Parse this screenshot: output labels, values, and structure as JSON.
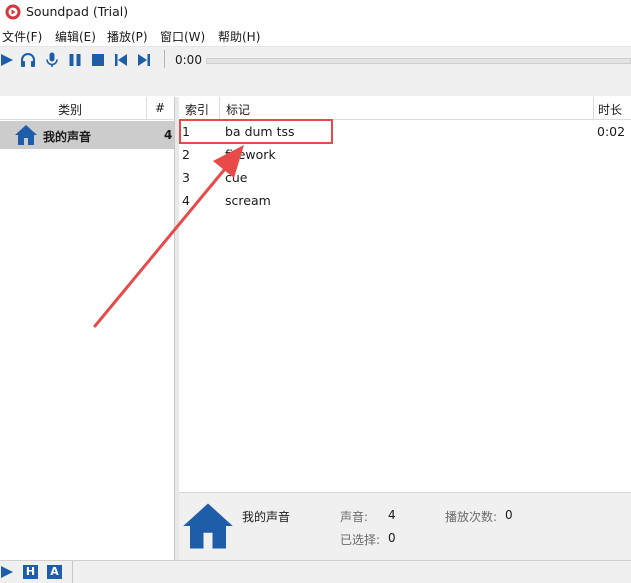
{
  "window": {
    "title": "Soundpad (Trial)"
  },
  "menu": [
    "文件(F)",
    "编辑(E)",
    "播放(P)",
    "窗口(W)",
    "帮助(H)"
  ],
  "toolbar": {
    "time": "0:00",
    "icons": [
      "play-icon",
      "headphones-icon",
      "microphone-icon",
      "pause-icon",
      "stop-icon",
      "previous-icon",
      "next-icon"
    ]
  },
  "categories": {
    "header": {
      "name": "类别",
      "count": "#"
    },
    "items": [
      {
        "name": "我的声音",
        "count": "4",
        "icon": "home-icon"
      }
    ]
  },
  "table": {
    "columns": {
      "index": "索引",
      "tag": "标记",
      "duration": "时长"
    },
    "rows": [
      {
        "index": "1",
        "tag": "ba dum tss",
        "duration": "0:02"
      },
      {
        "index": "2",
        "tag": "firework",
        "duration": ""
      },
      {
        "index": "3",
        "tag": "cue",
        "duration": ""
      },
      {
        "index": "4",
        "tag": "scream",
        "duration": ""
      }
    ]
  },
  "info": {
    "name": "我的声音",
    "sounds_label": "声音:",
    "sounds_value": "4",
    "plays_label": "播放次数:",
    "plays_value": "0",
    "selected_label": "已选择:",
    "selected_value": "0"
  },
  "statusbar": {
    "play_icon": "play-icon",
    "box_h": "H",
    "box_a": "A"
  },
  "colors": {
    "accent_blue": "#1e5ea8",
    "highlight_red": "#e84a4a",
    "selected_row": "#cccccc"
  }
}
